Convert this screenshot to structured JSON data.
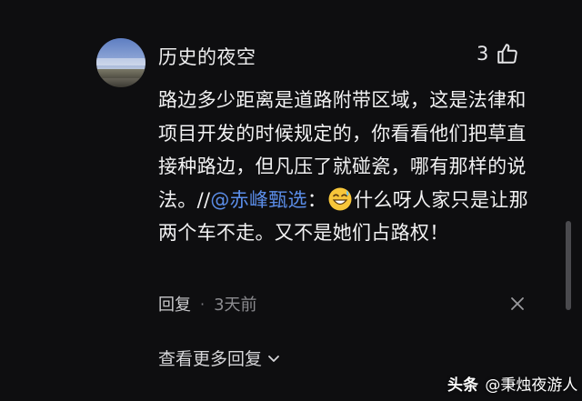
{
  "comment": {
    "username": "历史的夜空",
    "like_count": "3",
    "text_part1": "路边多少距离是道路附带区域，这是法律和项目开发的时候规定的，你看看他们把草直接种路边，但凡压了就碰瓷，哪有那样的说法。//",
    "mention": "@赤峰甄选",
    "text_part2": "：",
    "text_part3": "什么呀人家只是让那两个车不走。又不是她们占路权！",
    "emoji_name": "grinning-sweat-emoji",
    "mention_color": "#5b8de8"
  },
  "meta": {
    "reply_label": "回复",
    "separator": "·",
    "time": "3天前"
  },
  "more_replies": {
    "label": "查看更多回复"
  },
  "watermark": {
    "brand": "头条",
    "author": "@秉烛夜游人"
  },
  "icons": {
    "like": "thumbs-up-icon",
    "close": "close-icon",
    "expand": "chevron-down-icon"
  },
  "colors": {
    "background": "#0e0e10",
    "text": "#f2f2f3",
    "muted": "#8c8c90"
  }
}
